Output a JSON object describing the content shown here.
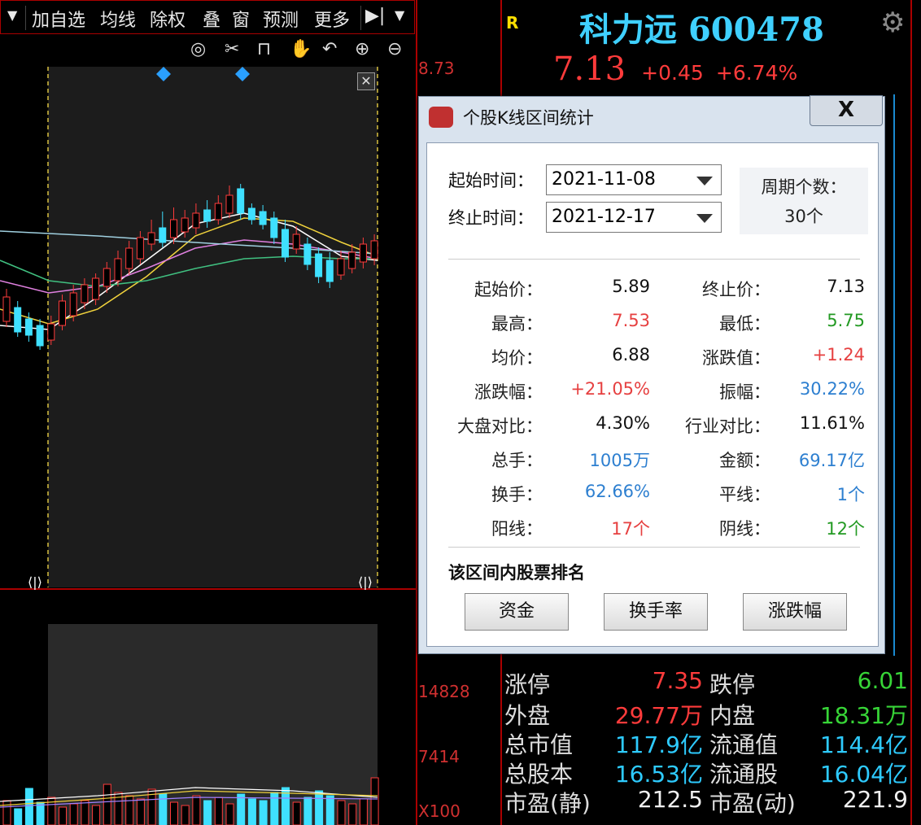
{
  "toolbar": {
    "items": [
      "加自选",
      "均线",
      "除权",
      "叠",
      "窗",
      "预测",
      "更多"
    ],
    "dropdown_icon": "chevron-down-icon",
    "play_icon": "skip-forward-icon"
  },
  "chart_toolbar_icons": [
    "eye-icon",
    "scissors-icon",
    "lock-icon",
    "hand-icon",
    "undo-icon",
    "zoom-in-icon",
    "zoom-out-icon"
  ],
  "axis_labels": {
    "price_top": "8.73",
    "volume_mid": "14828",
    "volume_low": "7414",
    "volume_unit": "X100"
  },
  "stock": {
    "r_badge": "R",
    "name": "科力远",
    "code": "600478",
    "price": "7.13",
    "change": "+0.45",
    "change_pct": "+6.74%"
  },
  "quote_rows": [
    {
      "l1": "涨停",
      "v1": "7.35",
      "l2": "跌停",
      "v2": "6.01",
      "c1": "red",
      "c2": "green"
    },
    {
      "l1": "外盘",
      "v1": "29.77万",
      "l2": "内盘",
      "v2": "18.31万",
      "c1": "red",
      "c2": "green"
    },
    {
      "l1": "总市值",
      "v1": "117.9亿",
      "l2": "流通值",
      "v2": "114.4亿",
      "c1": "cyan",
      "c2": "cyan"
    },
    {
      "l1": "总股本",
      "v1": "16.53亿",
      "l2": "流通股",
      "v2": "16.04亿",
      "c1": "cyan",
      "c2": "cyan"
    },
    {
      "l1": "市盈(静)",
      "v1": "212.5",
      "l2": "市盈(动)",
      "v2": "221.9",
      "c1": "white",
      "c2": "white"
    }
  ],
  "dialog": {
    "title": "个股K线区间统计",
    "close_label": "X",
    "start_label": "起始时间：",
    "start_value": "2021-11-08",
    "end_label": "终止时间：",
    "end_value": "2021-12-17",
    "period_label": "周期个数：",
    "period_value": "30个",
    "stats": [
      {
        "l1": "起始价：",
        "v1": "5.89",
        "c1": "black",
        "l2": "终止价：",
        "v2": "7.13",
        "c2": "black"
      },
      {
        "l1": "最高：",
        "v1": "7.53",
        "c1": "red",
        "l2": "最低：",
        "v2": "5.75",
        "c2": "green"
      },
      {
        "l1": "均价：",
        "v1": "6.88",
        "c1": "black",
        "l2": "涨跌值：",
        "v2": "+1.24",
        "c2": "red"
      },
      {
        "l1": "涨跌幅：",
        "v1": "+21.05%",
        "c1": "red",
        "l2": "振幅：",
        "v2": "30.22%",
        "c2": "blue"
      },
      {
        "l1": "大盘对比：",
        "v1": "4.30%",
        "c1": "black",
        "l2": "行业对比：",
        "v2": "11.61%",
        "c2": "black"
      },
      {
        "l1": "总手：",
        "v1": "1005万",
        "c1": "blue",
        "l2": "金额：",
        "v2": "69.17亿",
        "c2": "blue"
      },
      {
        "l1": "换手：",
        "v1": "62.66%",
        "c1": "blue",
        "l2": "平线：",
        "v2": "1个",
        "c2": "blue"
      },
      {
        "l1": "阳线：",
        "v1": "17个",
        "c1": "red",
        "l2": "阴线：",
        "v2": "12个",
        "c2": "green"
      }
    ],
    "ranking_label": "该区间内股票排名",
    "buttons": [
      "资金",
      "换手率",
      "涨跌幅"
    ]
  },
  "colors": {
    "up": "#ff3b3b",
    "down": "#3fe0ff",
    "ma5": "#ffffff",
    "ma10": "#f0d23c",
    "ma20": "#e080e0",
    "ma60": "#40c080"
  }
}
